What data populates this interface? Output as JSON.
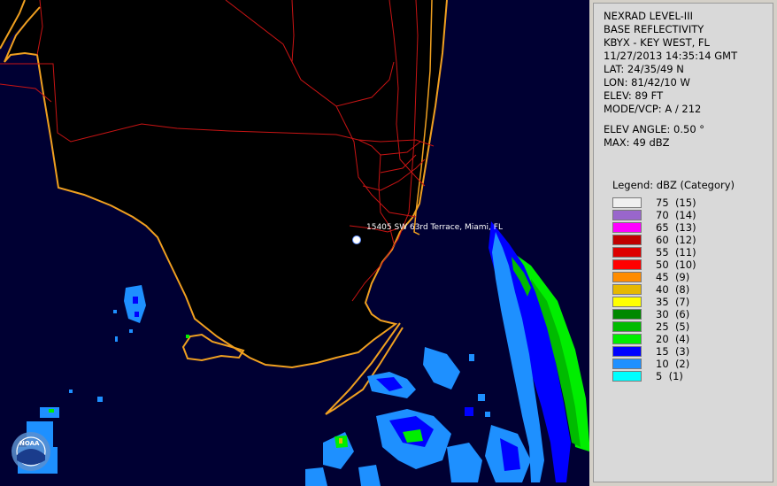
{
  "map": {
    "marker_label": "15405 SW 63rd Terrace, Miami, FL",
    "logo_text": "NOAA",
    "colors": {
      "background": "#000033",
      "land": "#000000",
      "coast": "#f0a020",
      "roads": "#c81414"
    }
  },
  "info": {
    "product": "NEXRAD LEVEL-III",
    "type": "BASE REFLECTIVITY",
    "station": "KBYX - KEY WEST, FL",
    "datetime": "11/27/2013 14:35:14 GMT",
    "lat": "LAT: 24/35/49 N",
    "lon": "LON: 81/42/10 W",
    "elev": "ELEV: 89 FT",
    "mode": "MODE/VCP: A / 212",
    "elev_angle": "ELEV ANGLE: 0.50 °",
    "max": "MAX: 49 dBZ"
  },
  "legend": {
    "title": "Legend: dBZ (Category)",
    "items": [
      {
        "label": "75  (15)",
        "color": "#f0f0f0"
      },
      {
        "label": "70  (14)",
        "color": "#9966cc"
      },
      {
        "label": "65  (13)",
        "color": "#ff00ff"
      },
      {
        "label": "60  (12)",
        "color": "#c00000"
      },
      {
        "label": "55  (11)",
        "color": "#dd0000"
      },
      {
        "label": "50  (10)",
        "color": "#ff0000"
      },
      {
        "label": "45  (9)",
        "color": "#ff8c00"
      },
      {
        "label": "40  (8)",
        "color": "#e6b800"
      },
      {
        "label": "35  (7)",
        "color": "#ffff00"
      },
      {
        "label": "30  (6)",
        "color": "#008800"
      },
      {
        "label": "25  (5)",
        "color": "#00bb00"
      },
      {
        "label": "20  (4)",
        "color": "#00ee00"
      },
      {
        "label": "15  (3)",
        "color": "#0000ff"
      },
      {
        "label": "10  (2)",
        "color": "#1e90ff"
      },
      {
        "label": "5  (1)",
        "color": "#00ffff"
      }
    ]
  }
}
